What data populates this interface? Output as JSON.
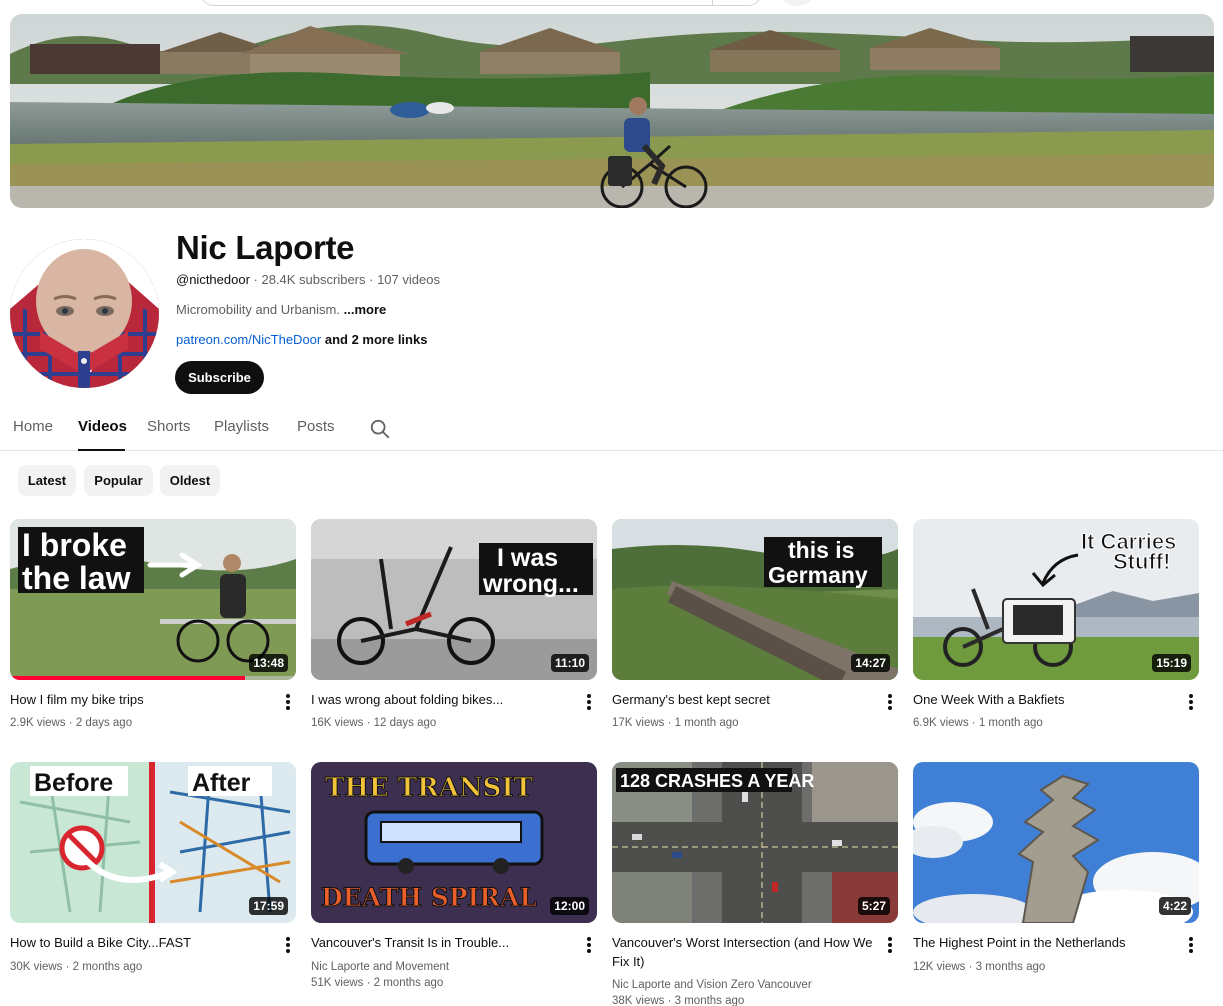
{
  "channel": {
    "name": "Nic Laporte",
    "handle": "@nicthedoor",
    "stats": " · 28.4K subscribers · 107 videos",
    "description": "Micromobility and Urbanism. ",
    "description_more": "...more",
    "link": "patreon.com/NicTheDoor",
    "link_more": " and 2 more links",
    "subscribe_label": "Subscribe"
  },
  "tabs": [
    {
      "label": "Home"
    },
    {
      "label": "Videos"
    },
    {
      "label": "Shorts"
    },
    {
      "label": "Playlists"
    },
    {
      "label": "Posts"
    }
  ],
  "chips": [
    {
      "label": "Latest"
    },
    {
      "label": "Popular"
    },
    {
      "label": "Oldest"
    }
  ],
  "videos": [
    {
      "title": "How I film my bike trips",
      "views": "2.9K views · 2 days ago",
      "duration": "13:48",
      "overlay": [
        "I broke",
        "the law"
      ],
      "watched_fraction": 0.82
    },
    {
      "title": "I was wrong about folding bikes...",
      "views": "16K views · 12 days ago",
      "duration": "11:10",
      "overlay": [
        "I was",
        "wrong..."
      ]
    },
    {
      "title": "Germany's best kept secret",
      "views": "17K views · 1 month ago",
      "duration": "14:27",
      "overlay": [
        "this is",
        "Germany"
      ]
    },
    {
      "title": "One Week With a Bakfiets",
      "views": "6.9K views · 1 month ago",
      "duration": "15:19",
      "overlay": [
        "It Carries",
        "Stuff!"
      ]
    },
    {
      "title": "How to Build a Bike City...FAST",
      "views": "30K views · 2 months ago",
      "duration": "17:59",
      "overlay": [
        "Before",
        "After"
      ]
    },
    {
      "title": "Vancouver's Transit Is in Trouble...",
      "channel": "Nic Laporte and Movement",
      "views": "51K views · 2 months ago",
      "duration": "12:00",
      "overlay": [
        "THE TRANSIT",
        "DEATH SPIRAL"
      ]
    },
    {
      "title": "Vancouver's Worst Intersection (and How We Fix It)",
      "channel": "Nic Laporte and Vision Zero Vancouver",
      "views": "38K views · 3 months ago",
      "duration": "5:27",
      "overlay": [
        "128 CRASHES A YEAR"
      ]
    },
    {
      "title": "The Highest Point in the Netherlands",
      "views": "12K views · 3 months ago",
      "duration": "4:22"
    }
  ],
  "icons": {
    "search": "search-icon",
    "menu": "more-vert-icon"
  },
  "colors": {
    "accent": "#ff0033",
    "link": "#065fd4",
    "button": "#0f0f0f"
  }
}
